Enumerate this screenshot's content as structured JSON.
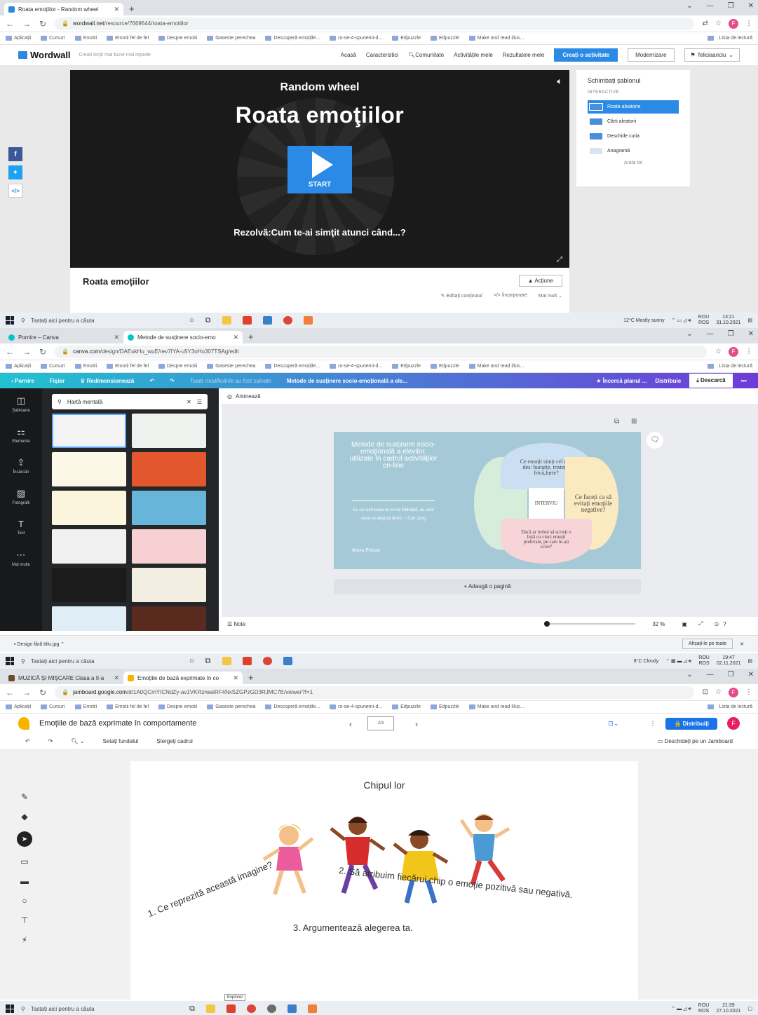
{
  "common": {
    "bookmarks": [
      "Aplicații",
      "Cursuri",
      "Emotii",
      "Emotii fel de fel",
      "Despre emotii",
      "Gaseste perechea",
      "Descoperă emoțiile...",
      "ro-se-4-spunemi-d...",
      "Edpuzzle",
      "Edpuzzle",
      "Make and read illus..."
    ],
    "bookmarks_right": "Lista de lectură",
    "search_placeholder": "Tastați aici pentru a căuta",
    "keyboard_lang": [
      "ROU",
      "ROS"
    ]
  },
  "wordwall": {
    "tab_title": "Roata emoțiilor - Random wheel",
    "url_domain": "wordwall.net",
    "url_path": "/resource/7669544/roata-emotiilor",
    "logo": "Wordwall",
    "tagline": "Creați lecții mai bune mai repede",
    "nav": [
      "Acasă",
      "Caracteristici",
      "Comunitate",
      "Activitățile mele",
      "Rezultatele mele"
    ],
    "create_label": "Creați o activitate",
    "upgrade_label": "Modernizare",
    "user": "feliciaariciu",
    "player": {
      "template": "Random wheel",
      "title": "Roata emoţiilor",
      "start": "START",
      "question": "Rezolvă:Cum te-ai simţit atunci când...?"
    },
    "activity_name": "Roata emoţiilor",
    "action_label": "Acțiune",
    "links": [
      "Editați conținutul",
      "Încorporare",
      "Mai mult"
    ],
    "side": {
      "heading": "Schimbați șablonul",
      "section": "INTERACTIVE",
      "templates": [
        "Roata aleatorie",
        "Cărți aleatorii",
        "Deschide cutia",
        "Anagramă"
      ],
      "show_all": "Arata tot"
    },
    "weather": "12°C  Mostly sunny",
    "time": "13:21",
    "date": "31.10.2021"
  },
  "canva": {
    "tabs": [
      "Pornire – Canva",
      "Metode de susținere socio-emo"
    ],
    "url_domain": "canva.com",
    "url_path": "/design/DAEukHu_wuE/rev7IYA-u5Y3oHo307TSAg/edit",
    "top": {
      "home": "Pornire",
      "file": "Fișier",
      "resize": "Redimensionează",
      "saved": "Toate modificările au fost salvate",
      "doc_title": "Metode de susținere socio-emoțională a ele...",
      "try_plan": "Încercă planul ...",
      "share": "Distribuie",
      "download": "Descarcă"
    },
    "rail": [
      "Șabloane",
      "Elemente",
      "Încărcări",
      "Fotografii",
      "Text",
      "Mai multe"
    ],
    "search_value": "Hartă mentală",
    "animate": "Animează",
    "slide": {
      "title": "Metode de susținere socio-emoțională a elevilor, utilizate în cadrul activităților on-line",
      "quote": "Eu nu sunt ceea ce mi se întâmplă, eu sunt ceea ce aleg să devin. ~ Carl Jung",
      "author": "Ariciu Felicia",
      "center": "INTERVIU",
      "top": "Ce emoții simți cel mai des: bucurie, tristețe, frică,furie?",
      "right": "Ce faceți ca să evitați emoțiile negative?",
      "bottom": "Dacă ar trebui să scrieți o listă cu cinci emoții preferate, pe care le-ați scrie?"
    },
    "add_page": "+ Adaugă o pagină",
    "notes": "Note",
    "zoom": "32 %",
    "download_file": "Design fără titlu.jpg",
    "show_all_downloads": "Afișați-le pe toate",
    "weather": "8°C  Cloudy",
    "time": "19:47",
    "date": "02.11.2021"
  },
  "jamboard": {
    "tabs": [
      "MUZICĂ ȘI MIȘCARE Clasa a II-a",
      "Emoțiile de bază exprimate în co"
    ],
    "url_domain": "jamboard.google.com",
    "url_path": "/d/1A0QCmYICNdZy-av1VKRzrwaiRF4NxSZGPzGD3RJMC7E/viewer?f=1",
    "title": "Emoțiile de bază exprimate în comportamente",
    "frame": "2/3",
    "share": "Distribuiți",
    "avatar": "F",
    "toolbar": [
      "Setați fundalul",
      "Ștergeți cadrul"
    ],
    "open_in": "Deschideți pe un Jamboard",
    "board_title": "Chipul lor",
    "q1": "1. Ce reprezită această imagine?",
    "q2": "2. Să atribuim fiecărui chip o emoție pozitivă sau negativă.",
    "q3": "3. Argumentează alegerea ta.",
    "tooltip": "Explorer",
    "time": "21:39",
    "date": "27.10.2021"
  }
}
